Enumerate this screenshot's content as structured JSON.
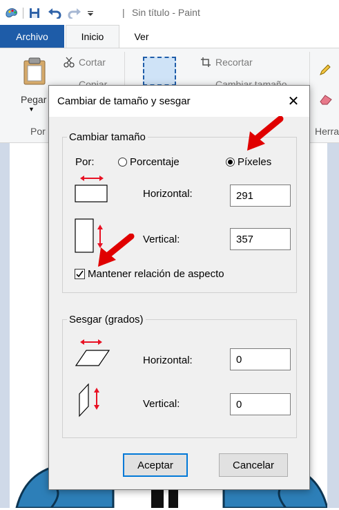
{
  "window": {
    "title_separator": "|",
    "title": "Sin título - Paint"
  },
  "quick_access": {
    "icons": [
      "paint-app-icon",
      "save-icon",
      "undo-icon",
      "redo-icon",
      "customize-dropdown-icon"
    ]
  },
  "ribbon": {
    "tabs": [
      "Archivo",
      "Inicio",
      "Ver"
    ],
    "clipboard": {
      "paste_label": "Pegar",
      "cut_label": "Cortar",
      "copy_label": "Copiar",
      "group_label": "Por"
    },
    "image": {
      "crop_label": "Recortar",
      "resize_label": "Cambiar tamaño"
    },
    "tools": {
      "group_label": "Herra"
    }
  },
  "dialog": {
    "title": "Cambiar de tamaño y sesgar",
    "close_glyph": "✕",
    "resize": {
      "legend": "Cambiar tamaño",
      "by_label": "Por:",
      "percent_label": "Porcentaje",
      "pixels_label": "Píxeles",
      "selected": "pixels",
      "horizontal_label": "Horizontal:",
      "horizontal_value": "291",
      "vertical_label": "Vertical:",
      "vertical_value": "357",
      "keep_aspect_label": "Mantener relación de aspecto",
      "keep_aspect_checked": true
    },
    "skew": {
      "legend": "Sesgar (grados)",
      "horizontal_label": "Horizontal:",
      "horizontal_value": "0",
      "vertical_label": "Vertical:",
      "vertical_value": "0"
    },
    "buttons": {
      "accept": "Aceptar",
      "cancel": "Cancelar"
    }
  },
  "colors": {
    "file_tab": "#1e5ca8",
    "annotation_arrow": "#e00000",
    "icon_red": "#e81123",
    "dialog_bg": "#f0f0f0"
  }
}
